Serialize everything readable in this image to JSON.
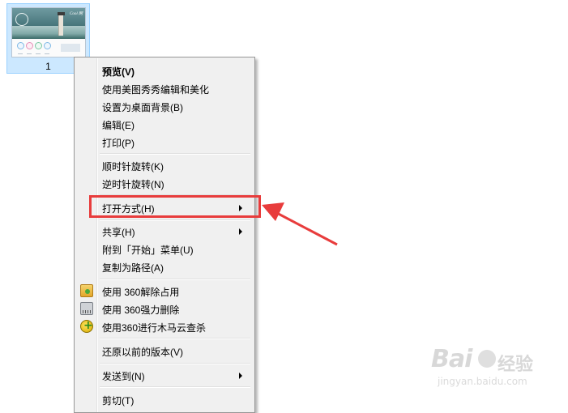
{
  "file": {
    "label": "1"
  },
  "thumbnail": {
    "brand_text": "Cool 网"
  },
  "menu": {
    "items": [
      {
        "label": "预览(V)",
        "bold": true
      },
      {
        "label": "使用美图秀秀编辑和美化"
      },
      {
        "label": "设置为桌面背景(B)"
      },
      {
        "label": "编辑(E)"
      },
      {
        "label": "打印(P)"
      },
      {
        "label": "顺时针旋转(K)"
      },
      {
        "label": "逆时针旋转(N)"
      },
      {
        "label": "打开方式(H)",
        "submenu": true
      },
      {
        "label": "共享(H)",
        "submenu": true
      },
      {
        "label": "附到「开始」菜单(U)"
      },
      {
        "label": "复制为路径(A)"
      },
      {
        "label": "使用 360解除占用",
        "icon": "folder-unlock-icon"
      },
      {
        "label": "使用 360强力删除",
        "icon": "shredder-icon"
      },
      {
        "label": "使用360进行木马云查杀",
        "icon": "360-scan-icon"
      },
      {
        "label": "还原以前的版本(V)"
      },
      {
        "label": "发送到(N)",
        "submenu": true
      },
      {
        "label": "剪切(T)"
      }
    ]
  },
  "annotation": {
    "highlight_color": "#e83c3c"
  },
  "watermark": {
    "brand": "Bai",
    "cn": "经验",
    "url": "jingyan.baidu.com"
  }
}
